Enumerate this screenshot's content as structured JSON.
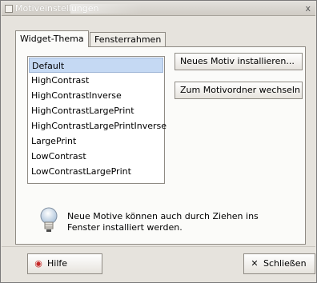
{
  "window": {
    "title": "Motiveinstellungen",
    "close_glyph": "x"
  },
  "tabs": [
    {
      "label": "Widget-Thema",
      "active": true
    },
    {
      "label": "Fensterrahmen",
      "active": false
    }
  ],
  "theme_list": {
    "items": [
      "Default",
      "HighContrast",
      "HighContrastInverse",
      "HighContrastLargePrint",
      "HighContrastLargePrintInverse",
      "LargePrint",
      "LowContrast",
      "LowContrastLargePrint"
    ],
    "selected_index": 0
  },
  "buttons": {
    "install": "Neues Motiv installieren...",
    "folder": "Zum Motivordner wechseln",
    "help": "Hilfe",
    "close": "Schließen"
  },
  "hint": {
    "text": "Neue Motive können auch durch Ziehen ins Fenster installiert werden."
  },
  "icons": {
    "window": "window-icon",
    "hint": "lightbulb-icon",
    "help": "help-icon",
    "close": "close-icon"
  },
  "colors": {
    "selected": "#c5d9f3",
    "window_bg": "#e6e3dd"
  }
}
